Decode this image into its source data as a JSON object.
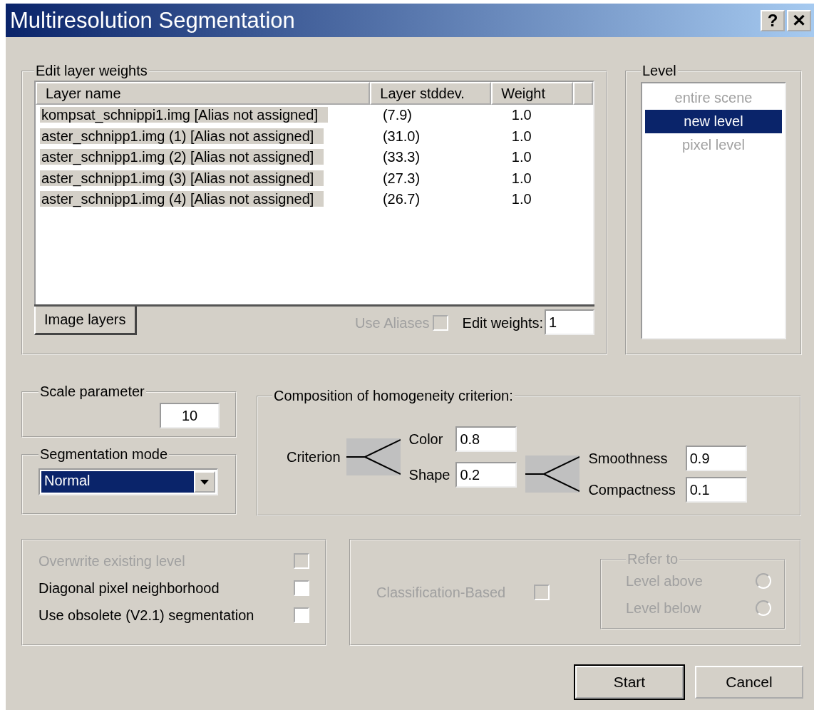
{
  "window": {
    "title": "Multiresolution Segmentation",
    "buttons": [
      "?",
      "✕"
    ]
  },
  "layer_weights": {
    "title": "Edit layer weights",
    "columns": [
      "Layer name",
      "Layer stddev.",
      "Weight"
    ],
    "rows": [
      {
        "name": "kompsat_schnippi1.img [Alias not assigned]",
        "stddev": "(7.9)",
        "weight": "1.0"
      },
      {
        "name": "aster_schnipp1.img (1) [Alias not assigned]",
        "stddev": "(31.0)",
        "weight": "1.0"
      },
      {
        "name": "aster_schnipp1.img (2) [Alias not assigned]",
        "stddev": "(33.3)",
        "weight": "1.0"
      },
      {
        "name": "aster_schnipp1.img (3) [Alias not assigned]",
        "stddev": "(27.3)",
        "weight": "1.0"
      },
      {
        "name": "aster_schnipp1.img (4) [Alias not assigned]",
        "stddev": "(26.7)",
        "weight": "1.0"
      }
    ],
    "tabs": [
      {
        "label": "Image layers",
        "selected": true
      }
    ],
    "use_aliases": {
      "label": "Use Aliases",
      "checked": false,
      "disabled": true
    },
    "edit_weights": {
      "label": "Edit weights:",
      "value": "1"
    }
  },
  "level": {
    "title": "Level",
    "items": [
      {
        "label": "entire scene",
        "selected": false,
        "disabled": true
      },
      {
        "label": "new level",
        "selected": true,
        "disabled": false
      },
      {
        "label": "pixel level",
        "selected": false,
        "disabled": true
      }
    ]
  },
  "scale_parameter": {
    "title": "Scale parameter",
    "value": "10"
  },
  "segmentation_mode": {
    "title": "Segmentation mode",
    "value": "Normal"
  },
  "homogeneity": {
    "title": "Composition of homogeneity criterion:",
    "criterion_label": "Criterion",
    "color": {
      "label": "Color",
      "value": "0.8"
    },
    "shape": {
      "label": "Shape",
      "value": "0.2"
    },
    "smoothness": {
      "label": "Smoothness",
      "value": "0.9"
    },
    "compactness": {
      "label": "Compactness",
      "value": "0.1"
    }
  },
  "options": [
    {
      "label": "Overwrite existing level",
      "checked": false,
      "disabled": true
    },
    {
      "label": "Diagonal pixel neighborhood",
      "checked": false,
      "disabled": false
    },
    {
      "label": "Use obsolete (V2.1) segmentation",
      "checked": false,
      "disabled": false
    }
  ],
  "classification": {
    "label": "Classification-Based",
    "checked": false,
    "disabled": true,
    "refer_to": {
      "title": "Refer to",
      "options": [
        {
          "label": "Level above",
          "selected": false,
          "disabled": true
        },
        {
          "label": "Level below",
          "selected": false,
          "disabled": true
        }
      ]
    }
  },
  "buttons": [
    "Start",
    "Cancel"
  ]
}
